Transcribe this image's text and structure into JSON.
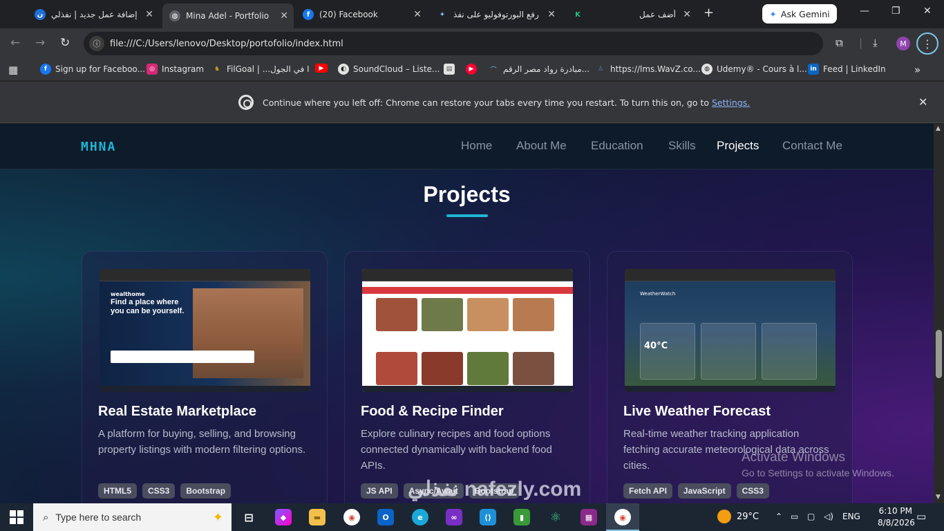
{
  "browser": {
    "tabs": [
      {
        "title": "إضافة عمل جديد | نفذلي",
        "icon": "nafezly-icon",
        "active": false
      },
      {
        "title": "Mina Adel - Portfolio",
        "icon": "globe-icon",
        "active": true
      },
      {
        "title": "(20) Facebook",
        "icon": "facebook-icon",
        "active": false
      },
      {
        "title": "رفع البورتوفوليو على نفذ",
        "icon": "gemini-icon",
        "active": false
      },
      {
        "title": "أضف عمل",
        "icon": "k-icon",
        "active": false
      }
    ],
    "gemini_label": "Ask Gemini",
    "url": "file:///C:/Users/lenovo/Desktop/portofolio/index.html",
    "profile_initial": "M",
    "bookmarks": [
      {
        "label": "Sign up for Faceboo...",
        "icon": "facebook-icon",
        "color": "#1877f2"
      },
      {
        "label": "Instagram",
        "icon": "instagram-icon",
        "color": "#d62976"
      },
      {
        "label": "FilGoal | ...ا في الجول",
        "icon": "filgoal-icon",
        "color": "#c9a227"
      },
      {
        "label": "",
        "icon": "youtube-icon",
        "color": "#ff0000"
      },
      {
        "label": "SoundCloud – Liste...",
        "icon": "soundcloud-icon",
        "color": "#e3e3e3"
      },
      {
        "label": "",
        "icon": "document-icon",
        "color": "#e3e3e3"
      },
      {
        "label": "",
        "icon": "youtube-circle-icon",
        "color": "#ff0033"
      },
      {
        "label": "مبادرة رواد مصر الرقم...",
        "icon": "rowad-icon",
        "color": "#6a9bb5"
      },
      {
        "label": "https://lms.WavZ.co...",
        "icon": "wavz-icon",
        "color": "#5c7db3"
      },
      {
        "label": "Udemy® - Cours à l...",
        "icon": "udemy-icon",
        "color": "#e3e3e3"
      },
      {
        "label": "Feed | LinkedIn",
        "icon": "linkedin-icon",
        "color": "#0a66c2"
      }
    ],
    "restore_message": "Continue where you left off: Chrome can restore your tabs every time you restart. To turn this on, go to ",
    "restore_link": "Settings."
  },
  "site": {
    "logo": "MHNA",
    "nav": [
      "Home",
      "About Me",
      "Education",
      "Skills",
      "Projects",
      "Contact Me"
    ],
    "active_nav": "Projects",
    "section_title": "Projects",
    "projects": [
      {
        "title": "Real Estate Marketplace",
        "description": "A platform for buying, selling, and browsing property listings with modern filtering options.",
        "tags": [
          "HTML5",
          "CSS3",
          "Bootstrap"
        ],
        "screenshot_brand": "wealthome",
        "screenshot_headline": "Find a place where you can be yourself."
      },
      {
        "title": "Food & Recipe Finder",
        "description": "Explore culinary recipes and food options connected dynamically with backend food APIs.",
        "tags": [
          "JS API",
          "Async/Await",
          "Bootstrap"
        ]
      },
      {
        "title": "Live Weather Forecast",
        "description": "Real-time weather tracking application fetching accurate meteorological data across cities.",
        "tags": [
          "Fetch API",
          "JavaScript",
          "CSS3"
        ],
        "screenshot_brand": "WeatherWatch",
        "screenshot_temp": "40°C"
      }
    ]
  },
  "overlay": {
    "activate_title": "Activate Windows",
    "activate_sub": "Go to Settings to activate Windows.",
    "watermark": "نفذلي nafezly.com"
  },
  "taskbar": {
    "search_placeholder": "Type here to search",
    "weather": "29°C",
    "language": "ENG",
    "time": "6:10 PM",
    "date": "8/8/2026"
  }
}
